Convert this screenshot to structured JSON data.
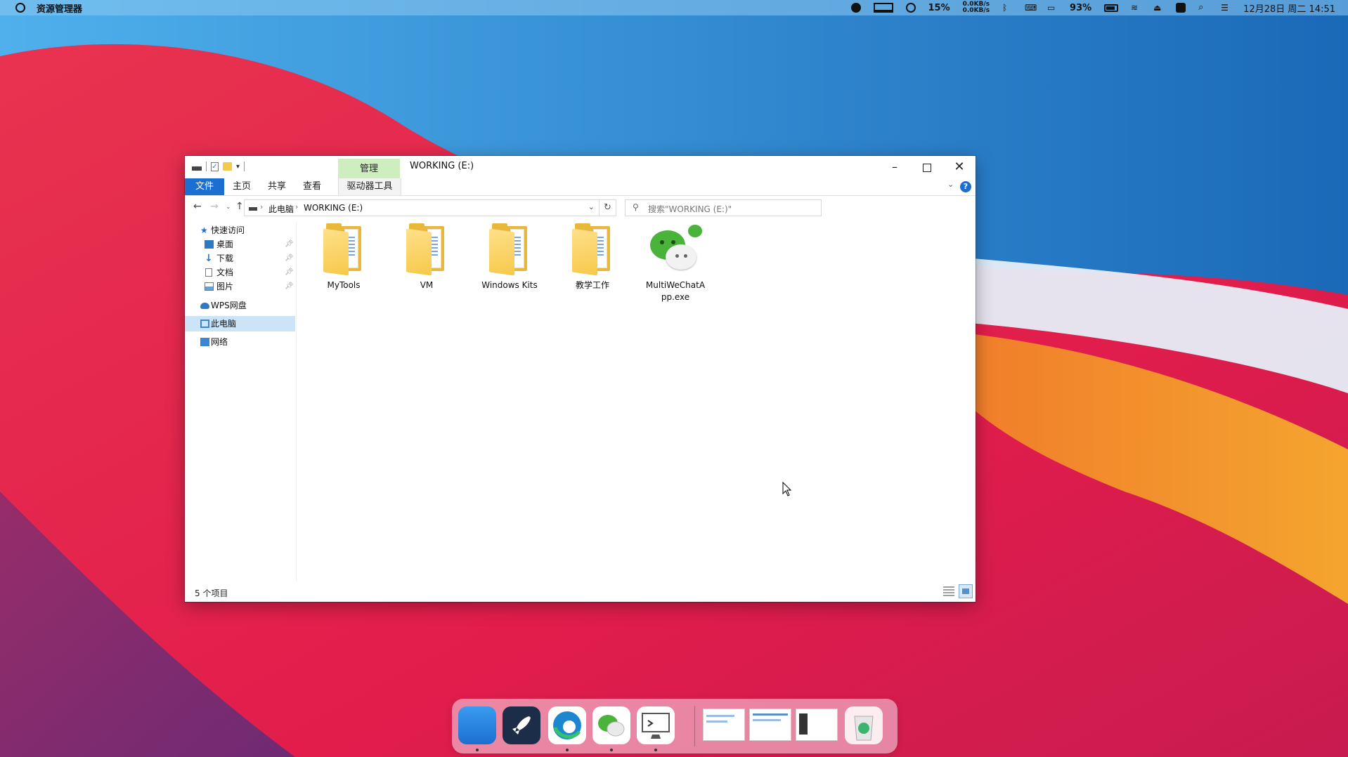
{
  "menubar": {
    "app_name": "资源管理器",
    "cpu": "15%",
    "net_up": "0.0KB/s",
    "net_down": "0.0KB/s",
    "battery": "93%",
    "clock": "12月28日 周二 14:51"
  },
  "window": {
    "manage_tab": "管理",
    "title": "WORKING (E:)",
    "ribbon": {
      "file": "文件",
      "home": "主页",
      "share": "共享",
      "view": "查看",
      "drive_tools": "驱动器工具"
    },
    "address": {
      "root": "此电脑",
      "current": "WORKING (E:)"
    },
    "search_placeholder": "搜索\"WORKING (E:)\"",
    "sidebar": {
      "quick_access": "快速访问",
      "desktop": "桌面",
      "downloads": "下载",
      "documents": "文档",
      "pictures": "图片",
      "wps": "WPS网盘",
      "this_pc": "此电脑",
      "network": "网络"
    },
    "items": [
      {
        "name": "MyTools"
      },
      {
        "name": "VM"
      },
      {
        "name": "Windows Kits"
      },
      {
        "name": "教学工作"
      },
      {
        "name": "MultiWeChatApp.exe"
      }
    ],
    "status": "5 个项目"
  },
  "colors": {
    "accent": "#1a6fd1",
    "manage_tab": "#cfeec0",
    "wechat_green": "#4ab33a",
    "folder_yellow": "#f6c94a"
  }
}
